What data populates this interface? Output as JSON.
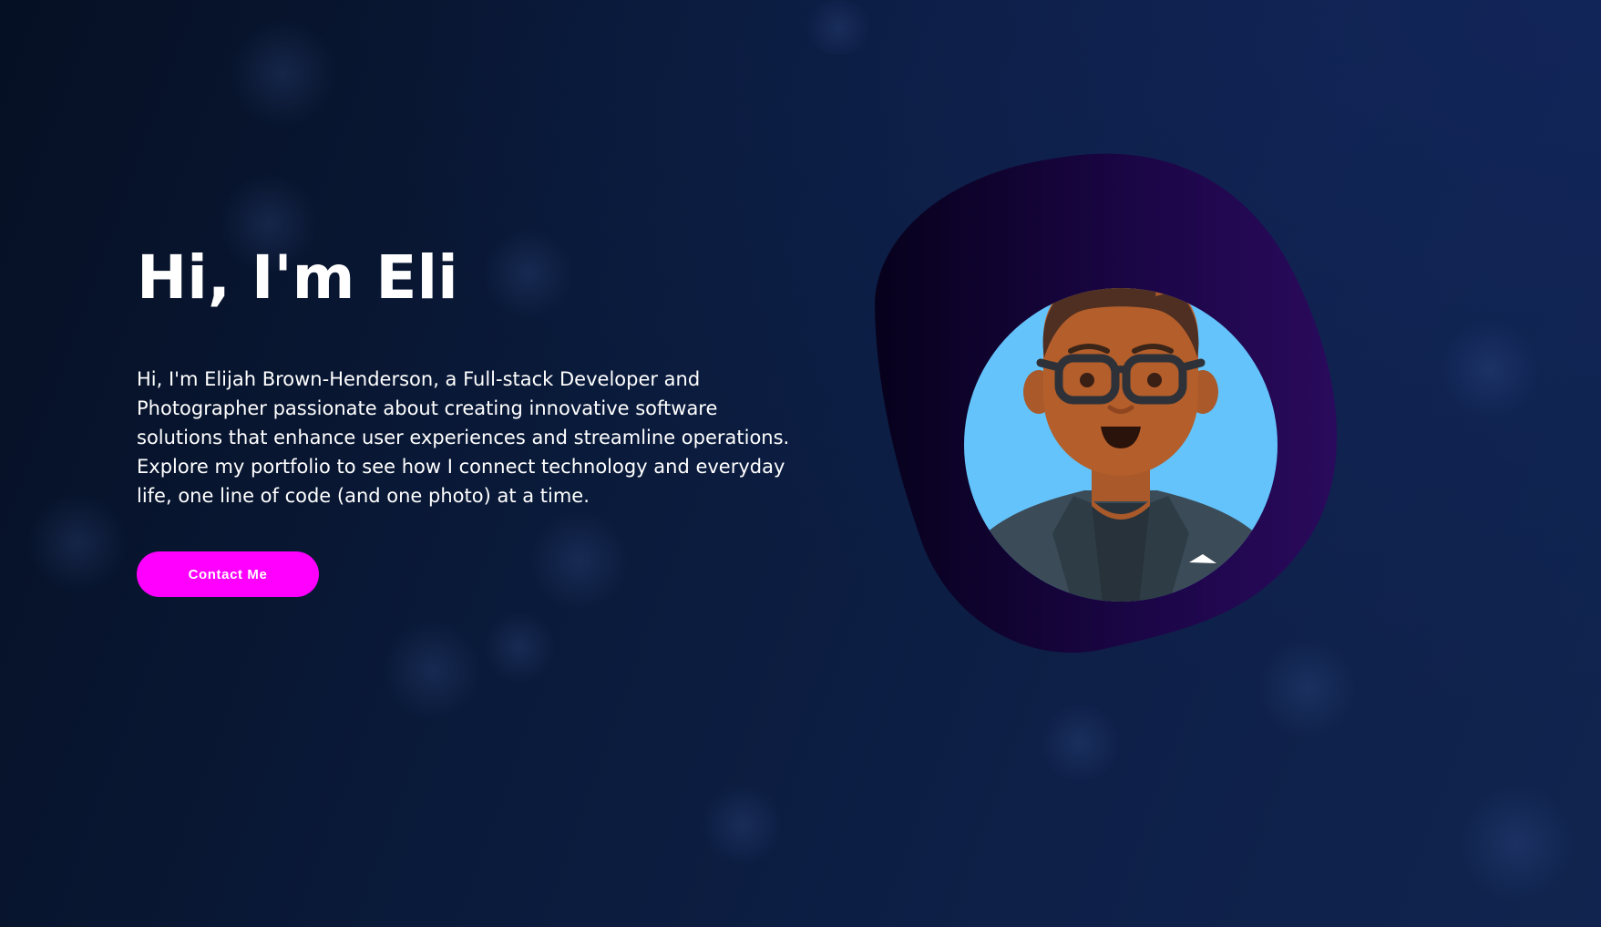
{
  "hero": {
    "title": "Hi, I'm Eli",
    "intro": "Hi, I'm Elijah Brown-Henderson, a Full-stack Developer and Photographer passionate about creating innovative software solutions that enhance user experiences and streamline operations. Explore my portfolio to see how I connect technology and everyday life, one line of code (and one photo) at a time.",
    "contact_label": "Contact Me"
  },
  "portrait": {
    "icon": "developer-avatar-icon",
    "blob_colors": [
      "#07011c",
      "#1c0648",
      "#2a0a5c"
    ],
    "circle_color": "#64c3fa"
  },
  "colors": {
    "accent": "#ff00ff",
    "background": "#0a1a3a",
    "text": "#ffffff"
  }
}
